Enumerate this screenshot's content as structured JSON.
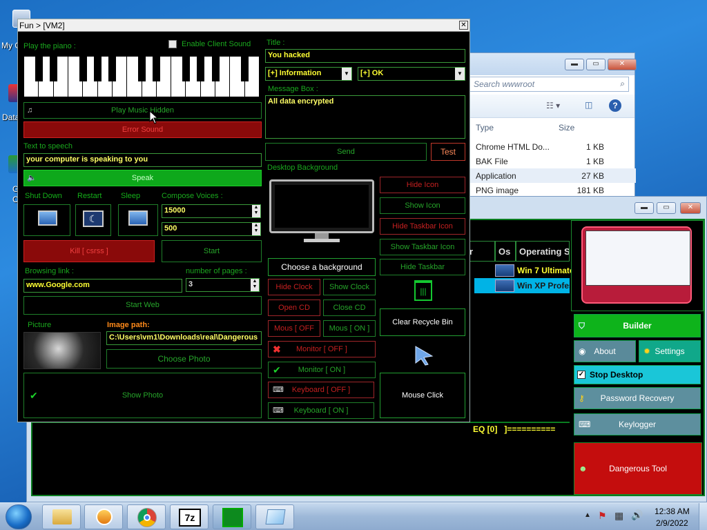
{
  "desktop": {
    "icons": [
      {
        "label": "My C"
      },
      {
        "label": "Data"
      },
      {
        "label": "G"
      },
      {
        "label": "C"
      }
    ]
  },
  "explorer": {
    "search_placeholder": "Search wwwroot",
    "columns": [
      "Type",
      "Size"
    ],
    "files": [
      {
        "type": "Chrome HTML Do...",
        "size": "1 KB"
      },
      {
        "type": "BAK File",
        "size": "1 KB"
      },
      {
        "type": "Application",
        "size": "27 KB"
      },
      {
        "type": "PNG image",
        "size": "181 KB"
      }
    ]
  },
  "rat": {
    "columns": {
      "r": "r",
      "os": "Os",
      "operating": "Operating Sys"
    },
    "clients": [
      {
        "os": "Win 7 Ultimate"
      },
      {
        "os": "Win XP Profes"
      }
    ],
    "status_text": "EQ [0]   ]==========",
    "buttons": {
      "builder": "Builder",
      "about": "About",
      "settings": "Settings",
      "stop_desktop": "Stop Desktop",
      "password_recovery": "Password Recovery",
      "keylogger": "Keylogger",
      "dangerous_tool": "Dangerous Tool"
    }
  },
  "fun": {
    "title": "Fun > [VM2]",
    "labels": {
      "play_piano": "Play the piano :",
      "enable_client_sound": "Enable Client Sound",
      "text_to_speech": "Text to speech",
      "shut_down": "Shut Down",
      "restart": "Restart",
      "sleep": "Sleep",
      "compose_voices": "Compose Voices :",
      "browsing_link": "Browsing link :",
      "number_of_pages": "number of pages :",
      "picture": "Picture",
      "image_path": "Image path:",
      "title": "Title :",
      "message_box": "Message Box :",
      "desktop_background": "Desktop Background"
    },
    "buttons": {
      "play_music_hidden": "Play Music Hidden",
      "error_sound": "Error Sound",
      "speak": "Speak",
      "kill_csrss": "Kill [ csrss ]",
      "start": "Start",
      "start_web": "Start Web",
      "choose_photo": "Choose Photo",
      "show_photo": "Show Photo",
      "send": "Send",
      "test": "Test",
      "choose_background": "Choose a background",
      "hide_icon": "Hide Icon",
      "show_icon": "Show Icon",
      "hide_taskbar_icon": "Hide Taskbar Icon",
      "show_taskbar_icon": "Show Taskbar Icon",
      "hide_taskbar": "Hide Taskbar",
      "hide_clock": "Hide Clock",
      "show_clock": "Show Clock",
      "open_cd": "Open CD",
      "close_cd": "Close CD",
      "mous_off": "Mous [ OFF",
      "mous_on": "Mous [ ON ]",
      "monitor_off": "Monitor [ OFF ]",
      "monitor_on": "Monitor [ ON ]",
      "keyboard_off": "Keyboard  [ OFF ]",
      "keyboard_on": "Keyboard   [ ON ]",
      "clear_recycle_bin": "Clear Recycle Bin",
      "mouse_click": "Mouse Click"
    },
    "inputs": {
      "speech_text": "your computer is speaking to you",
      "voice_freq": "15000",
      "voice_duration": "500",
      "browsing_link": "www.Google.com",
      "pages": "3",
      "image_path": "C:\\Users\\vm1\\Downloads\\real\\Dangerous",
      "title": "You hacked",
      "message": "All data encrypted"
    },
    "selects": {
      "icon_type": "[+] Information",
      "button_type": "[+] OK"
    }
  },
  "taskbar": {
    "time": "12:38 AM",
    "date": "2/9/2022"
  }
}
